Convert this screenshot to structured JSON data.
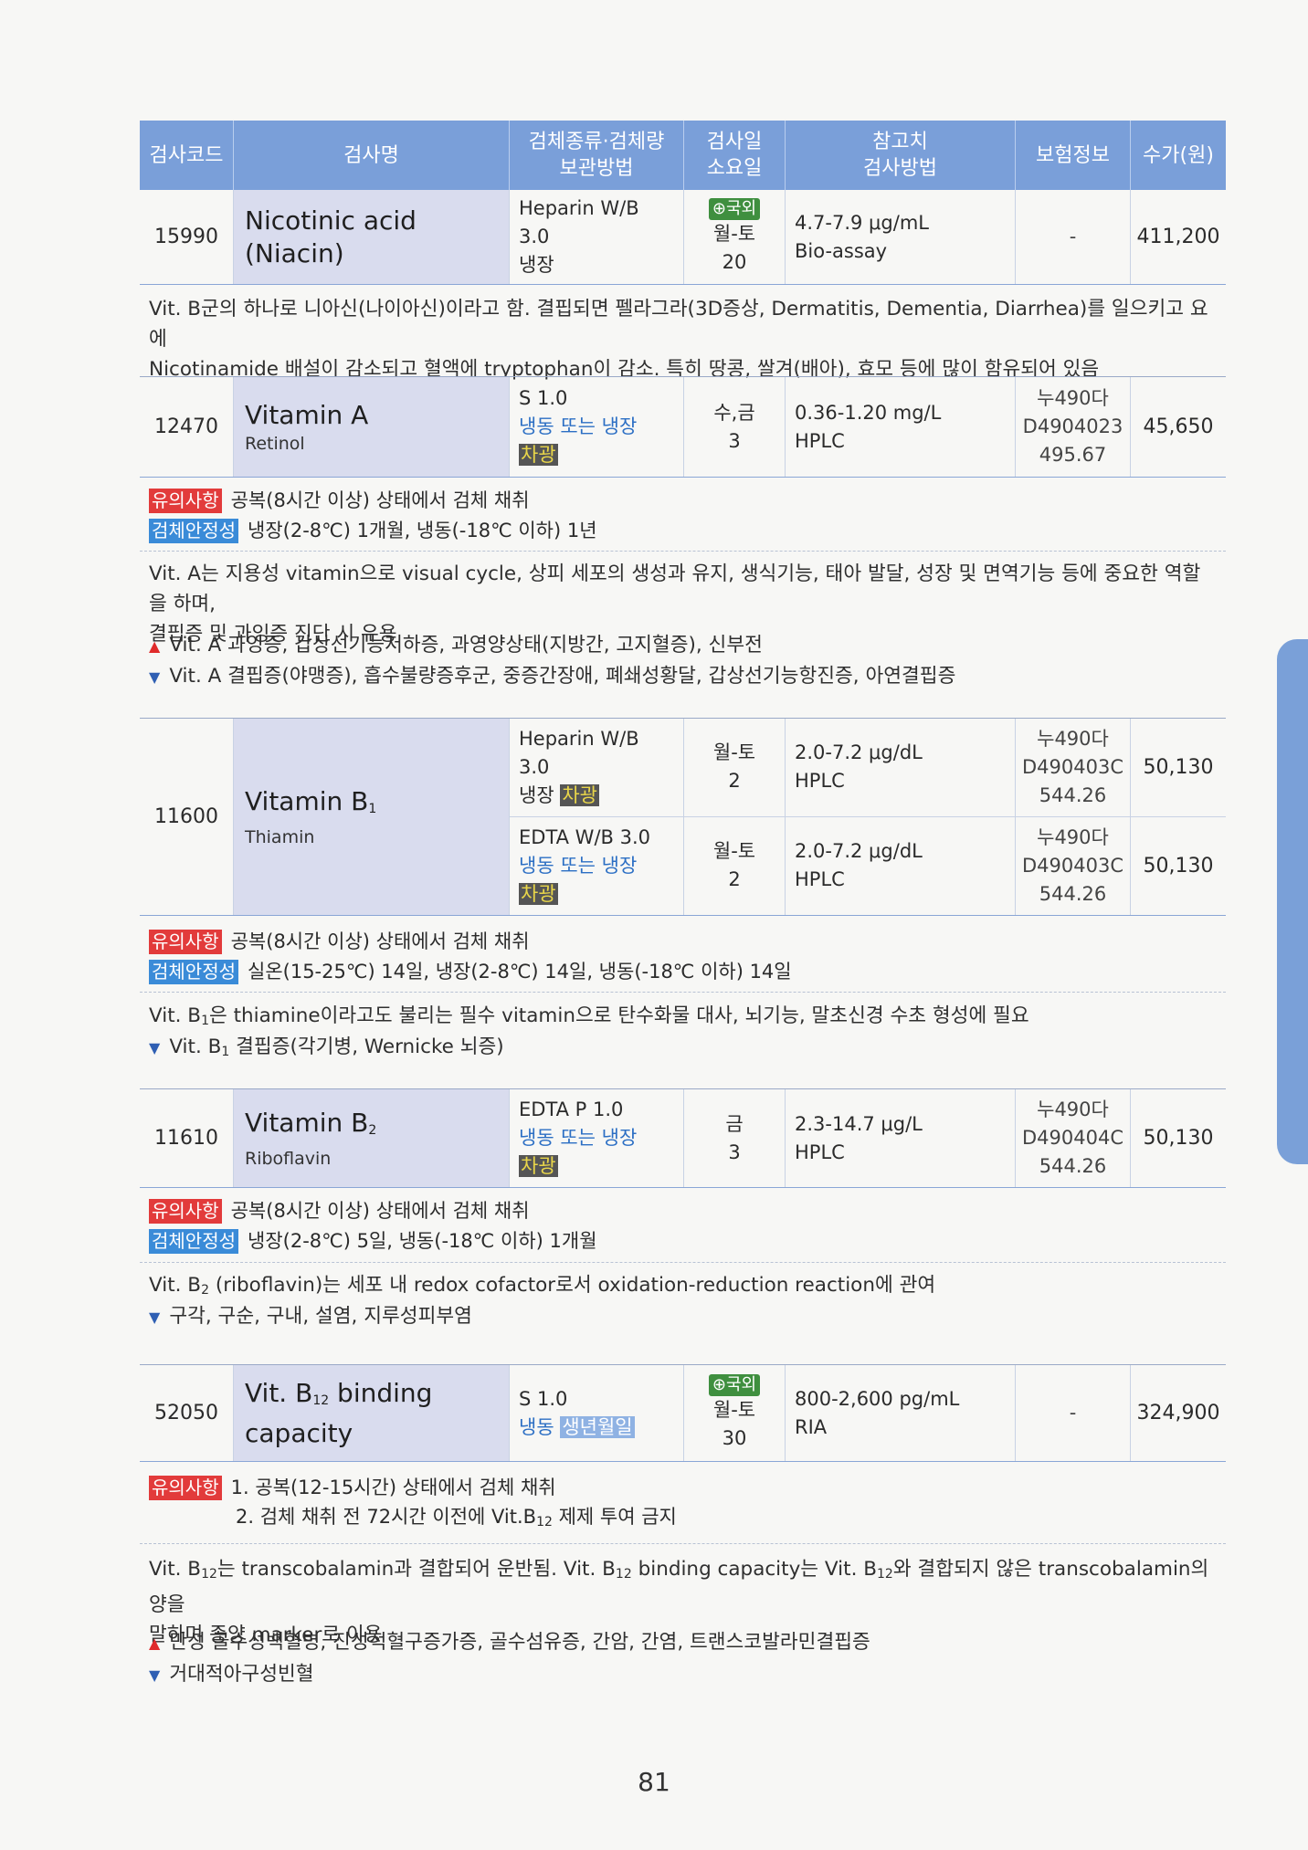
{
  "header": {
    "code": "검사코드",
    "name": "검사명",
    "specimen": [
      "검체종류·검체량",
      "보관방법"
    ],
    "days": [
      "검사일",
      "소요일"
    ],
    "ref": [
      "참고치",
      "검사방법"
    ],
    "insurance": "보험정보",
    "price": "수가(원)"
  },
  "abroad_label": "⊕국외",
  "tests": {
    "niacin": {
      "code": "15990",
      "name": "Nicotinic acid (Niacin)",
      "specimen": [
        "Heparin W/B 3.0",
        "냉장"
      ],
      "days": [
        "월-토",
        "20"
      ],
      "ref": [
        "4.7-7.9 μg/mL",
        "Bio-assay"
      ],
      "insurance": "-",
      "price": "411,200",
      "desc": [
        "Vit. B군의 하나로 니아신(나이아신)이라고 함. 결핍되면 펠라그라(3D증상, Dermatitis, Dementia, Diarrhea)를 일으키고 요에",
        "Nicotinamide 배설이 감소되고 혈액에 tryptophan이 감소. 특히 땅콩, 쌀겨(배아), 효모 등에 많이 함유되어 있음"
      ]
    },
    "vita": {
      "code": "12470",
      "name": "Vitamin A",
      "sub": "Retinol",
      "specimen": [
        "S 1.0",
        "냉동 또는 냉장",
        "차광"
      ],
      "days": [
        "수,금",
        "3"
      ],
      "ref": [
        "0.36-1.20 mg/L",
        "HPLC"
      ],
      "insurance": [
        "누490다",
        "D4904023",
        "495.67"
      ],
      "price": "45,650",
      "caution_label": "유의사항",
      "caution": "공복(8시간 이상) 상태에서 검체 채취",
      "stability_label": "검체안정성",
      "stability": "냉장(2-8℃) 1개월, 냉동(-18℃ 이하) 1년",
      "desc": [
        "Vit. A는 지용성 vitamin으로 visual cycle, 상피 세포의 생성과 유지, 생식기능, 태아 발달, 성장 및 면역기능 등에 중요한 역할을 하며,",
        "결핍증 및 과잉증 진단 시 유용"
      ],
      "up": "Vit. A 과잉증, 갑상선기능저하증, 과영양상태(지방간, 고지혈증), 신부전",
      "down": "Vit. A 결핍증(야맹증), 흡수불량증후군, 중증간장애, 폐쇄성황달, 갑상선기능항진증, 아연결핍증"
    },
    "vitb1": {
      "code": "11600",
      "name": "Vitamin B",
      "name_sub": "1",
      "sub": "Thiamin",
      "rows": [
        {
          "specimen": [
            "Heparin W/B 3.0",
            "냉장",
            "차광"
          ],
          "days": [
            "월-토",
            "2"
          ],
          "ref": [
            "2.0-7.2 μg/dL",
            "HPLC"
          ],
          "insurance": [
            "누490다",
            "D490403C",
            "544.26"
          ],
          "price": "50,130"
        },
        {
          "specimen": [
            "EDTA W/B 3.0",
            "냉동 또는 냉장",
            "차광"
          ],
          "days": [
            "월-토",
            "2"
          ],
          "ref": [
            "2.0-7.2 μg/dL",
            "HPLC"
          ],
          "insurance": [
            "누490다",
            "D490403C",
            "544.26"
          ],
          "price": "50,130"
        }
      ],
      "caution_label": "유의사항",
      "caution": "공복(8시간 이상) 상태에서 검체 채취",
      "stability_label": "검체안정성",
      "stability": "실온(15-25℃) 14일, 냉장(2-8℃) 14일, 냉동(-18℃ 이하) 14일",
      "desc_pre": "Vit. B",
      "desc_sub": "1",
      "desc_post": "은 thiamine이라고도 불리는 필수 vitamin으로 탄수화물 대사, 뇌기능, 말초신경 수초 형성에 필요",
      "down_pre": "Vit. B",
      "down_sub": "1",
      "down_post": " 결핍증(각기병, Wernicke 뇌증)"
    },
    "vitb2": {
      "code": "11610",
      "name": "Vitamin B",
      "name_sub": "2",
      "sub": "Riboflavin",
      "specimen": [
        "EDTA P 1.0",
        "냉동 또는 냉장",
        "차광"
      ],
      "days": [
        "금",
        "3"
      ],
      "ref": [
        "2.3-14.7 μg/L",
        "HPLC"
      ],
      "insurance": [
        "누490다",
        "D490404C",
        "544.26"
      ],
      "price": "50,130",
      "caution_label": "유의사항",
      "caution": "공복(8시간 이상) 상태에서 검체 채취",
      "stability_label": "검체안정성",
      "stability": "냉장(2-8℃) 5일, 냉동(-18℃ 이하) 1개월",
      "desc_pre": "Vit. B",
      "desc_sub": "2",
      "desc_post": " (riboflavin)는 세포 내 redox cofactor로서 oxidation-reduction reaction에 관여",
      "down": "구각, 구순, 구내, 설염, 지루성피부염"
    },
    "vitb12": {
      "code": "52050",
      "name_pre": "Vit. B",
      "name_sub": "12",
      "name_post": " binding capacity",
      "specimen": [
        "S 1.0",
        "냉동",
        "생년월일"
      ],
      "days": [
        "월-토",
        "30"
      ],
      "ref": [
        "800-2,600 pg/mL",
        "RIA"
      ],
      "insurance": "-",
      "price": "324,900",
      "caution_label": "유의사항",
      "caution1": "1. 공복(12-15시간) 상태에서 검체 채취",
      "caution2_pre": "2. 검체 채취 전 72시간 이전에 Vit.B",
      "caution2_sub": "12",
      "caution2_post": " 제제 투여 금지",
      "desc1_a": "Vit. B",
      "desc1_s1": "12",
      "desc1_b": "는 transcobalamin과 결합되어 운반됨. Vit. B",
      "desc1_s2": "12",
      "desc1_c": " binding capacity는 Vit. B",
      "desc1_s3": "12",
      "desc1_d": "와 결합되지 않은 transcobalamin의 양을",
      "desc2": "말하며 종양 marker로 이용",
      "up": "만성 골수성백혈병, 진성적혈구증가증, 골수섬유증, 간암, 간염, 트랜스코발라민결핍증",
      "down": "거대적아구성빈혈"
    }
  },
  "page_number": "81"
}
